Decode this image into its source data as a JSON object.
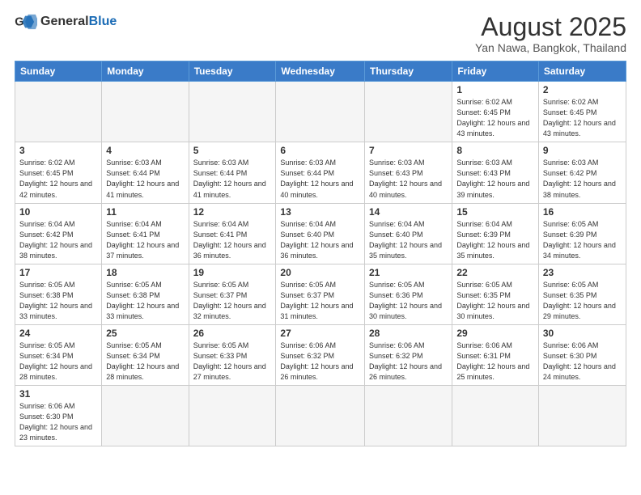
{
  "header": {
    "logo_general": "General",
    "logo_blue": "Blue",
    "month_year": "August 2025",
    "location": "Yan Nawa, Bangkok, Thailand"
  },
  "weekdays": [
    "Sunday",
    "Monday",
    "Tuesday",
    "Wednesday",
    "Thursday",
    "Friday",
    "Saturday"
  ],
  "weeks": [
    [
      {
        "day": "",
        "info": ""
      },
      {
        "day": "",
        "info": ""
      },
      {
        "day": "",
        "info": ""
      },
      {
        "day": "",
        "info": ""
      },
      {
        "day": "",
        "info": ""
      },
      {
        "day": "1",
        "info": "Sunrise: 6:02 AM\nSunset: 6:45 PM\nDaylight: 12 hours\nand 43 minutes."
      },
      {
        "day": "2",
        "info": "Sunrise: 6:02 AM\nSunset: 6:45 PM\nDaylight: 12 hours\nand 43 minutes."
      }
    ],
    [
      {
        "day": "3",
        "info": "Sunrise: 6:02 AM\nSunset: 6:45 PM\nDaylight: 12 hours\nand 42 minutes."
      },
      {
        "day": "4",
        "info": "Sunrise: 6:03 AM\nSunset: 6:44 PM\nDaylight: 12 hours\nand 41 minutes."
      },
      {
        "day": "5",
        "info": "Sunrise: 6:03 AM\nSunset: 6:44 PM\nDaylight: 12 hours\nand 41 minutes."
      },
      {
        "day": "6",
        "info": "Sunrise: 6:03 AM\nSunset: 6:44 PM\nDaylight: 12 hours\nand 40 minutes."
      },
      {
        "day": "7",
        "info": "Sunrise: 6:03 AM\nSunset: 6:43 PM\nDaylight: 12 hours\nand 40 minutes."
      },
      {
        "day": "8",
        "info": "Sunrise: 6:03 AM\nSunset: 6:43 PM\nDaylight: 12 hours\nand 39 minutes."
      },
      {
        "day": "9",
        "info": "Sunrise: 6:03 AM\nSunset: 6:42 PM\nDaylight: 12 hours\nand 38 minutes."
      }
    ],
    [
      {
        "day": "10",
        "info": "Sunrise: 6:04 AM\nSunset: 6:42 PM\nDaylight: 12 hours\nand 38 minutes."
      },
      {
        "day": "11",
        "info": "Sunrise: 6:04 AM\nSunset: 6:41 PM\nDaylight: 12 hours\nand 37 minutes."
      },
      {
        "day": "12",
        "info": "Sunrise: 6:04 AM\nSunset: 6:41 PM\nDaylight: 12 hours\nand 36 minutes."
      },
      {
        "day": "13",
        "info": "Sunrise: 6:04 AM\nSunset: 6:40 PM\nDaylight: 12 hours\nand 36 minutes."
      },
      {
        "day": "14",
        "info": "Sunrise: 6:04 AM\nSunset: 6:40 PM\nDaylight: 12 hours\nand 35 minutes."
      },
      {
        "day": "15",
        "info": "Sunrise: 6:04 AM\nSunset: 6:39 PM\nDaylight: 12 hours\nand 35 minutes."
      },
      {
        "day": "16",
        "info": "Sunrise: 6:05 AM\nSunset: 6:39 PM\nDaylight: 12 hours\nand 34 minutes."
      }
    ],
    [
      {
        "day": "17",
        "info": "Sunrise: 6:05 AM\nSunset: 6:38 PM\nDaylight: 12 hours\nand 33 minutes."
      },
      {
        "day": "18",
        "info": "Sunrise: 6:05 AM\nSunset: 6:38 PM\nDaylight: 12 hours\nand 33 minutes."
      },
      {
        "day": "19",
        "info": "Sunrise: 6:05 AM\nSunset: 6:37 PM\nDaylight: 12 hours\nand 32 minutes."
      },
      {
        "day": "20",
        "info": "Sunrise: 6:05 AM\nSunset: 6:37 PM\nDaylight: 12 hours\nand 31 minutes."
      },
      {
        "day": "21",
        "info": "Sunrise: 6:05 AM\nSunset: 6:36 PM\nDaylight: 12 hours\nand 30 minutes."
      },
      {
        "day": "22",
        "info": "Sunrise: 6:05 AM\nSunset: 6:35 PM\nDaylight: 12 hours\nand 30 minutes."
      },
      {
        "day": "23",
        "info": "Sunrise: 6:05 AM\nSunset: 6:35 PM\nDaylight: 12 hours\nand 29 minutes."
      }
    ],
    [
      {
        "day": "24",
        "info": "Sunrise: 6:05 AM\nSunset: 6:34 PM\nDaylight: 12 hours\nand 28 minutes."
      },
      {
        "day": "25",
        "info": "Sunrise: 6:05 AM\nSunset: 6:34 PM\nDaylight: 12 hours\nand 28 minutes."
      },
      {
        "day": "26",
        "info": "Sunrise: 6:05 AM\nSunset: 6:33 PM\nDaylight: 12 hours\nand 27 minutes."
      },
      {
        "day": "27",
        "info": "Sunrise: 6:06 AM\nSunset: 6:32 PM\nDaylight: 12 hours\nand 26 minutes."
      },
      {
        "day": "28",
        "info": "Sunrise: 6:06 AM\nSunset: 6:32 PM\nDaylight: 12 hours\nand 26 minutes."
      },
      {
        "day": "29",
        "info": "Sunrise: 6:06 AM\nSunset: 6:31 PM\nDaylight: 12 hours\nand 25 minutes."
      },
      {
        "day": "30",
        "info": "Sunrise: 6:06 AM\nSunset: 6:30 PM\nDaylight: 12 hours\nand 24 minutes."
      }
    ],
    [
      {
        "day": "31",
        "info": "Sunrise: 6:06 AM\nSunset: 6:30 PM\nDaylight: 12 hours\nand 23 minutes."
      },
      {
        "day": "",
        "info": ""
      },
      {
        "day": "",
        "info": ""
      },
      {
        "day": "",
        "info": ""
      },
      {
        "day": "",
        "info": ""
      },
      {
        "day": "",
        "info": ""
      },
      {
        "day": "",
        "info": ""
      }
    ]
  ]
}
